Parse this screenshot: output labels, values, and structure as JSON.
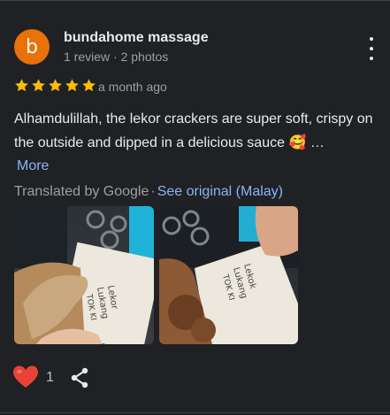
{
  "review": {
    "avatar_letter": "b",
    "reviewer_name": "bundahome massage",
    "reviewer_meta": "1 review · 2 photos",
    "rating": 5,
    "rating_max": 5,
    "time_ago": "a month ago",
    "text": "Alhamdulillah, the lekor crackers are super soft, crispy on the outside and dipped in a delicious sauce",
    "text_emoji": "🥰",
    "ellipsis": "…",
    "more_label": "More",
    "translated_by": "Translated by Google",
    "separator": "·",
    "see_original": "See original (Malay)",
    "like_count": "1"
  },
  "photos": [
    {
      "bag_text": "Lekor Lukang TOK KI"
    },
    {
      "bag_text": "Lekok Lukang TOK KI"
    }
  ],
  "colors": {
    "background": "#202124",
    "avatar": "#e8710a",
    "star": "#fbbc04",
    "link": "#8ab4f8",
    "heart": "#ea4335"
  },
  "icons": {
    "menu": "more-vert-icon",
    "like": "heart-icon",
    "share": "share-icon",
    "rating": "star-icon"
  }
}
